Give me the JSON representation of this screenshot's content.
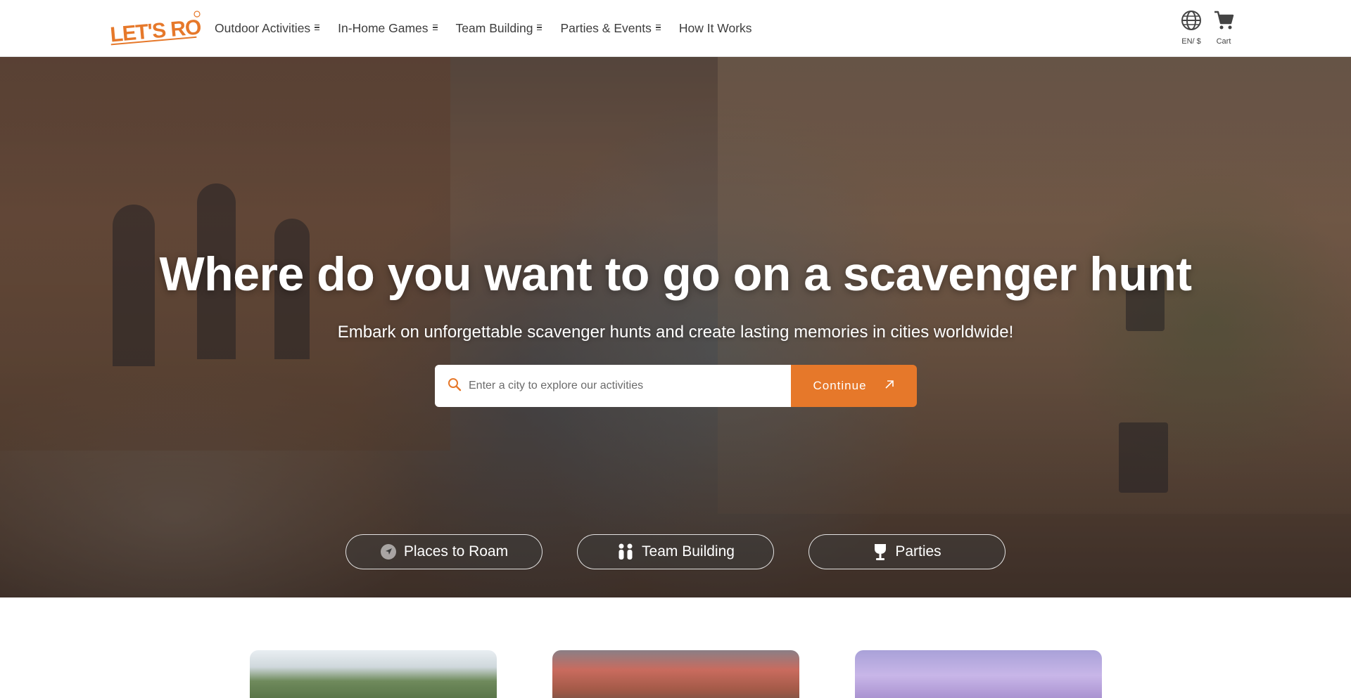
{
  "brand": {
    "logo_text": "LET'S ROAM",
    "registered_mark": "®",
    "accent_color": "#e6782a"
  },
  "nav": {
    "items": [
      {
        "label": "Outdoor Activities",
        "has_dropdown": true
      },
      {
        "label": "In-Home Games",
        "has_dropdown": true
      },
      {
        "label": "Team Building",
        "has_dropdown": true
      },
      {
        "label": "Parties & Events",
        "has_dropdown": true
      },
      {
        "label": "How It Works",
        "has_dropdown": false
      }
    ]
  },
  "header_actions": {
    "locale_label": "EN/ $",
    "locale_icon": "globe-icon",
    "cart_label": "Cart",
    "cart_icon": "cart-icon"
  },
  "hero": {
    "title": "Where do you want to go on a scavenger hunt",
    "subtitle": "Embark on unforgettable scavenger hunts and create lasting memories in cities worldwide!",
    "search": {
      "placeholder": "Enter a city to explore our activities",
      "value": "",
      "icon": "search-icon"
    },
    "continue_label": "Continue",
    "pills": [
      {
        "label": "Places to Roam",
        "icon": "navigation-icon"
      },
      {
        "label": "Team Building",
        "icon": "people-icon"
      },
      {
        "label": "Parties",
        "icon": "trophy-icon"
      }
    ]
  }
}
